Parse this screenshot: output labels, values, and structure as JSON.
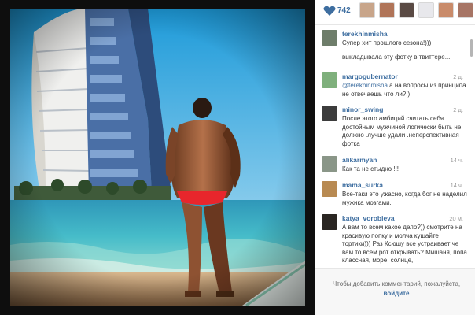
{
  "likes": {
    "count": "742",
    "likers": [
      {
        "icon": "avatar-1",
        "color": "#c8a58a"
      },
      {
        "icon": "avatar-2",
        "color": "#b07458"
      },
      {
        "icon": "avatar-3",
        "color": "#5a4a44"
      },
      {
        "icon": "avatar-4",
        "color": "#e8e8ec"
      },
      {
        "icon": "avatar-5",
        "color": "#c98b6a"
      },
      {
        "icon": "avatar-6",
        "color": "#a77565"
      }
    ]
  },
  "comments": [
    {
      "username": "terekhinmisha",
      "time": "",
      "text": "Супер хит прошлого сезона!)))",
      "extra": "выкладывала эту фотку в твиттере...",
      "avatar_color": "#6e7d6a"
    },
    {
      "username": "margogubernator",
      "time": "2 д.",
      "mention": "@terekhinmisha",
      "text": " а на вопросы из принципа не отвечаешь что ли?!)",
      "avatar_color": "#7fb07c"
    },
    {
      "username": "minor_swing",
      "time": "2 д.",
      "text": "После этого амбиций считать себя достойным мужчиной логически быть не должно .лучше удали .неперспективная фотка",
      "avatar_color": "#3c3c3c"
    },
    {
      "username": "alikarmyan",
      "time": "14 ч.",
      "text": "Как та не стыдно !!!",
      "avatar_color": "#8a9688"
    },
    {
      "username": "mama_surka",
      "time": "14 ч.",
      "text": "Все-таки это ужасно, когда бог не наделил мужика мозгами.",
      "avatar_color": "#b88a52"
    },
    {
      "username": "katya_vorobieva",
      "time": "20 м.",
      "text": "А вам то всем какое дело?)) смотрите на красивую попку и молча кушайте тортики))) Раз Ксюшу все устраивает че вам то всем рот открывать? Мишаня, попа классная, море, солнце,",
      "avatar_color": "#2a2622"
    }
  ],
  "login": {
    "prompt": "Чтобы добавить комментарий, пожалуйста,",
    "link": "войдите"
  }
}
